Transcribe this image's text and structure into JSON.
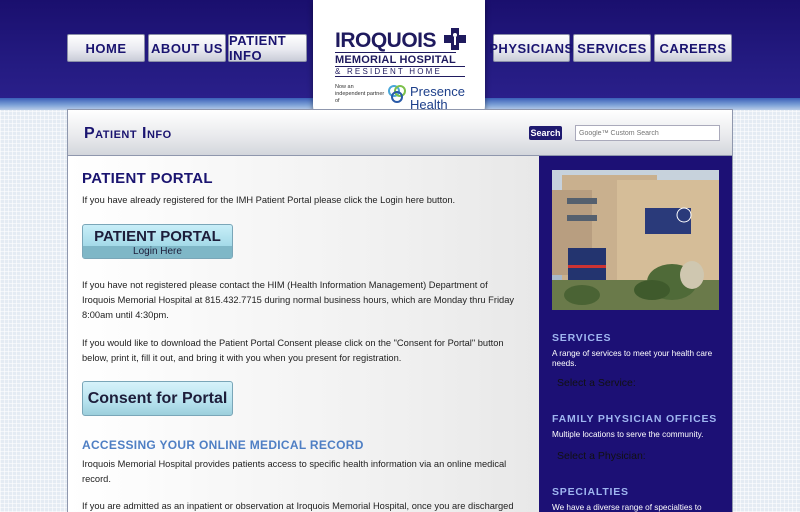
{
  "nav": {
    "home": "HOME",
    "about": "ABOUT US",
    "patient_info": "PATIENT INFO",
    "physicians": "PHYSICIANS",
    "services": "SERVICES",
    "careers": "CAREERS"
  },
  "logo": {
    "name": "IROQUOIS",
    "line2": "MEMORIAL HOSPITAL",
    "line3": "& RESIDENT HOME",
    "partner": "Now an independent partner of",
    "partner_name_1": "Presence",
    "partner_name_2": "Health"
  },
  "header": {
    "page_title": "Patient Info",
    "search_button": "Search",
    "search_placeholder": "Google™ Custom Search"
  },
  "main": {
    "heading": "PATIENT PORTAL",
    "intro": "If you have already registered for the IMH Patient Portal please click the Login here button.",
    "portal_button_title": "PATIENT PORTAL",
    "portal_button_sub": "Login Here",
    "not_registered": "If you have not registered please contact the HIM (Health Information Management) Department of Iroquois Memorial Hospital at 815.432.7715 during normal business hours, which are Monday thru Friday 8:00am until 4:30pm.",
    "download_consent": "If you would like to download the Patient Portal Consent please click on the \"Consent for Portal\" button below, print it, fill it out, and bring it with you when you present for registration.",
    "consent_button": "Consent for Portal",
    "subheading": "ACCESSING YOUR ONLINE MEDICAL RECORD",
    "access_text": "Iroquois Memorial Hospital provides patients access to specific health information via an online medical record.",
    "admitted_text": "If you are admitted as an inpatient or observation at Iroquois Memorial Hospital, once you are discharged"
  },
  "sidebar": {
    "services_title": "SERVICES",
    "services_text": "A range of services to meet your health care needs.",
    "services_select": "Select a Service:",
    "physician_title": "FAMILY PHYSICIAN OFFICES",
    "physician_text": "Multiple locations to serve the community.",
    "physician_select": "Select a Physician:",
    "specialties_title": "SPECIALTIES",
    "specialties_text": "We have a diverse range of specialties to"
  },
  "colors": {
    "header_navy": "#1a0f6e",
    "sidebar_navy": "#1c1075",
    "heading_blue": "#1a1470",
    "subheading_blue": "#4f7fc4"
  }
}
